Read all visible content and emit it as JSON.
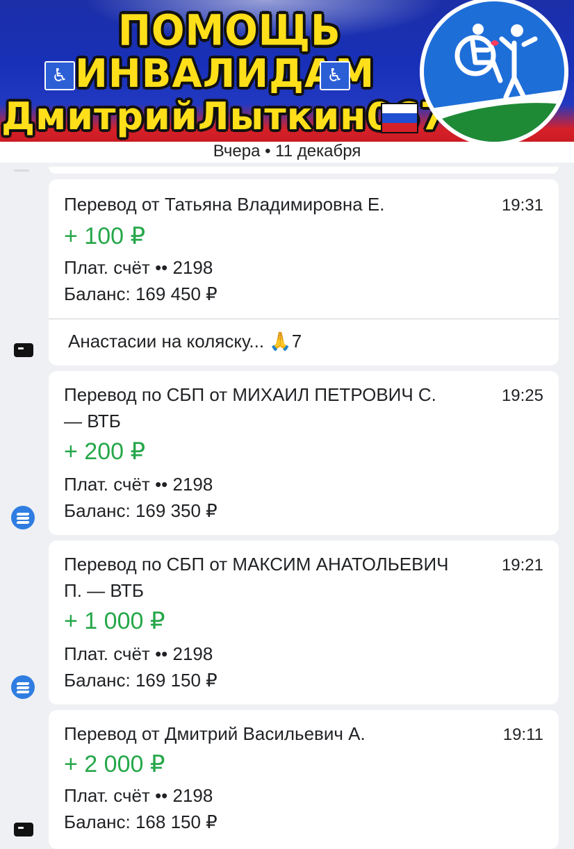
{
  "banner": {
    "line1": "ПОМОЩЬ",
    "line2": "ИНВАЛИДАМ",
    "line3": "ДмитрийЛыткин067",
    "wheelchair_glyph": "♿",
    "flag_colors": [
      "#ffffff",
      "#1f4fd0",
      "#d62028"
    ],
    "logo_icon": "caregiver-wheelchair-icon"
  },
  "date_header": "Вчера • 11 декабря",
  "accent_color": "#26a74a",
  "transactions": [
    {
      "title": "Перевод от Татьяна Владимировна Е.",
      "time": "19:31",
      "amount": "+ 100 ₽",
      "account": "Плат. счёт •• 2198",
      "balance": "Баланс: 169 450 ₽",
      "comment": "Анастасии на коляску... ",
      "comment_emoji": "🙏",
      "comment_tail": "7",
      "side_icon": "card-icon"
    },
    {
      "title": "Перевод по СБП от МИХАИЛ ПЕТРОВИЧ С.",
      "title_line2": "— ВТБ",
      "time": "19:25",
      "amount": "+ 200 ₽",
      "account": "Плат. счёт •• 2198",
      "balance": "Баланс: 169 350 ₽",
      "side_icon": "vtb-bank-icon"
    },
    {
      "title": "Перевод по СБП от МАКСИМ АНАТОЛЬЕВИЧ",
      "title_line2": "П. — ВТБ",
      "time": "19:21",
      "amount": "+ 1 000 ₽",
      "account": "Плат. счёт •• 2198",
      "balance": "Баланс: 169 150 ₽",
      "side_icon": "vtb-bank-icon"
    },
    {
      "title": "Перевод от Дмитрий Васильевич А.",
      "time": "19:11",
      "amount": "+ 2 000 ₽",
      "account": "Плат. счёт •• 2198",
      "balance": "Баланс: 168 150 ₽",
      "side_icon": "card-icon"
    }
  ]
}
